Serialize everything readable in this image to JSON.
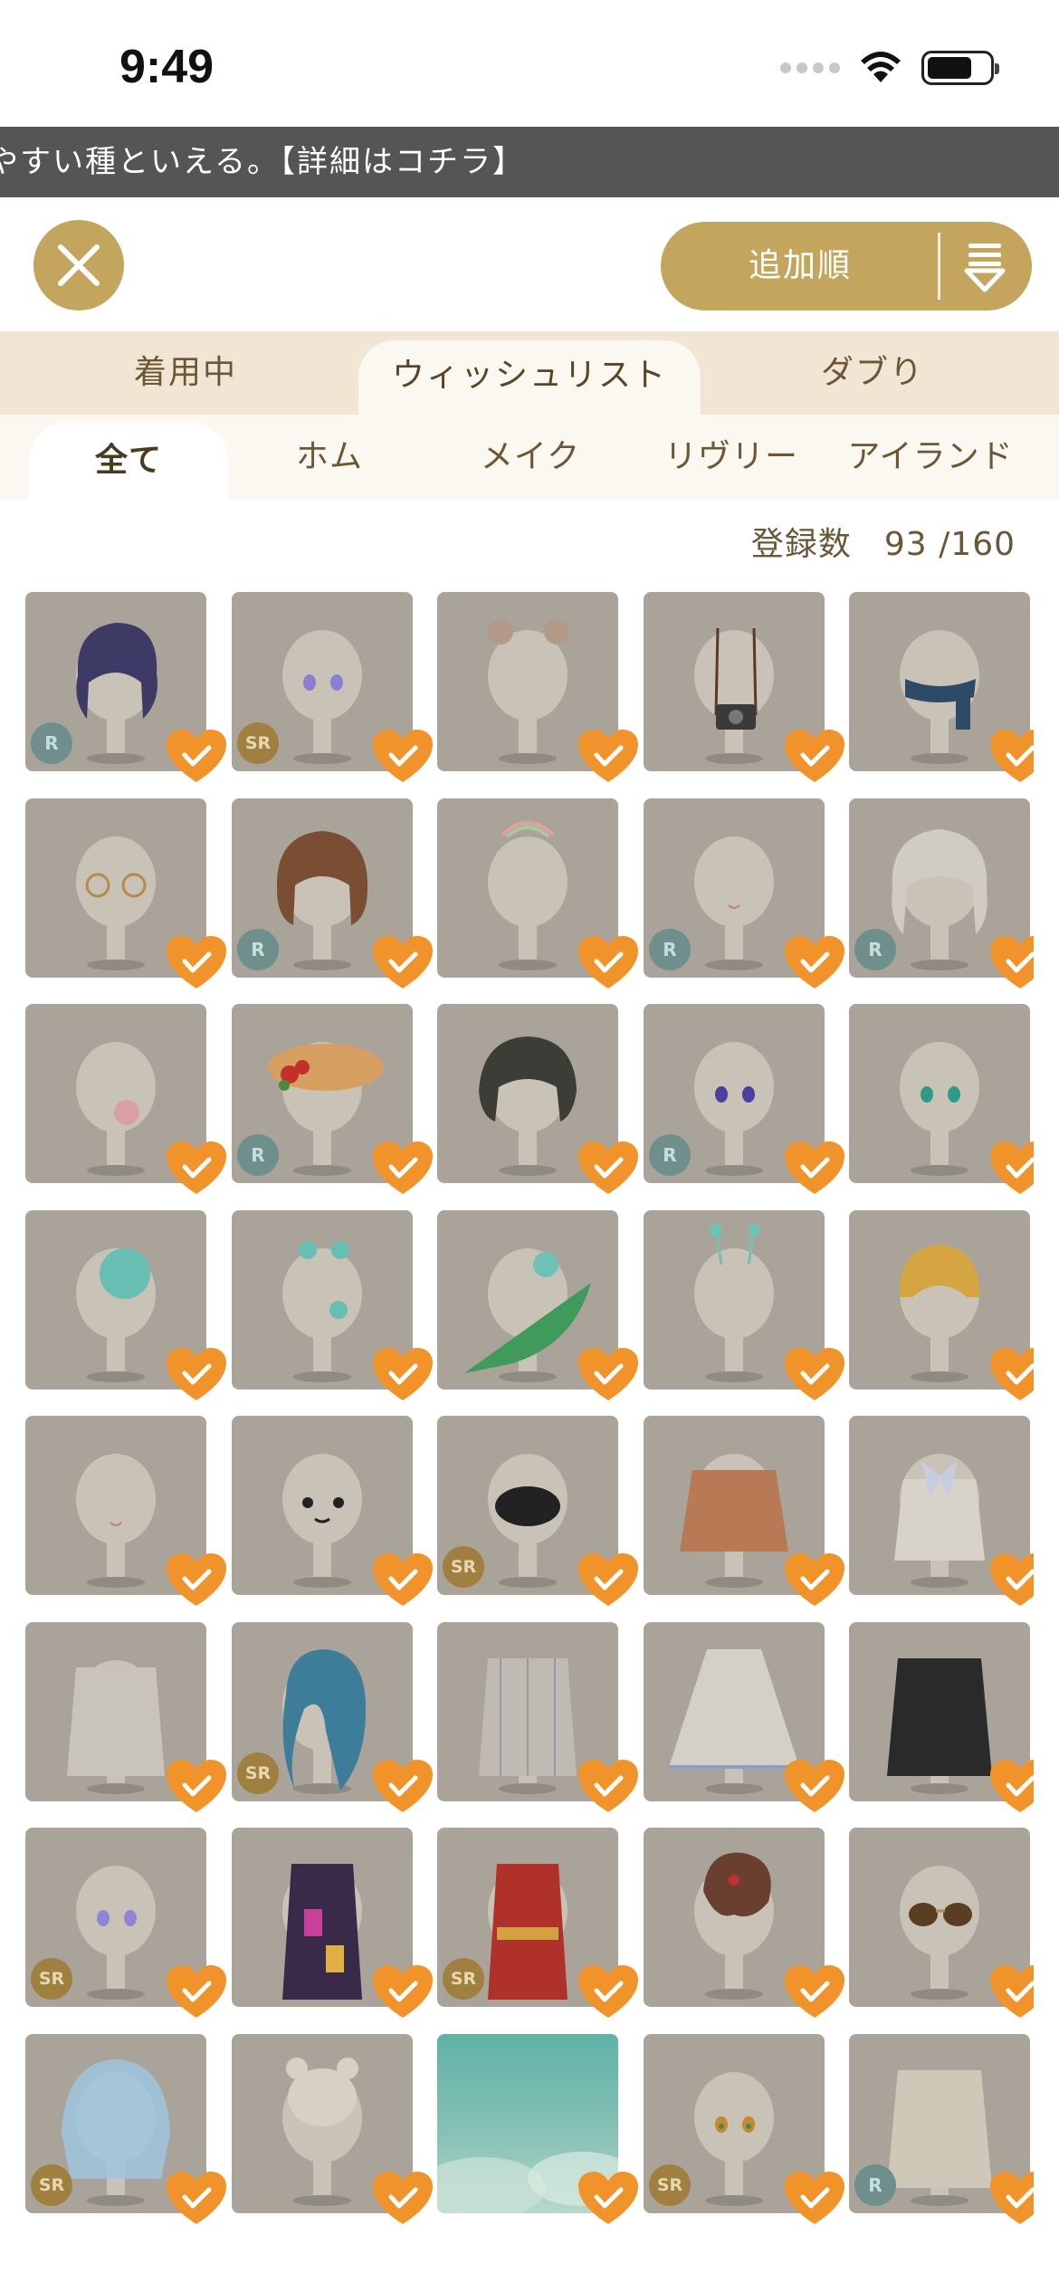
{
  "status_bar": {
    "time": "9:49"
  },
  "ticker": {
    "text": "やすい種といえる。【詳細はコチラ】"
  },
  "header": {
    "sort_label": "追加順"
  },
  "main_tabs": [
    {
      "label": "着用中",
      "active": false
    },
    {
      "label": "ウィッシュリスト",
      "active": true
    },
    {
      "label": "ダブり",
      "active": false
    }
  ],
  "sub_tabs": [
    {
      "label": "全て",
      "active": true
    },
    {
      "label": "ホム",
      "active": false
    },
    {
      "label": "メイク",
      "active": false
    },
    {
      "label": "リヴリー",
      "active": false
    },
    {
      "label": "アイランド",
      "active": false
    }
  ],
  "count": {
    "label": "登録数",
    "value": "93 /160"
  },
  "colors": {
    "accent": "#c4a55d",
    "heart": "#f0932b",
    "tab_bg": "#f0e6d3"
  },
  "items": [
    {
      "kind": "navy-hair",
      "rarity": "R"
    },
    {
      "kind": "purple-eyes",
      "rarity": "SR"
    },
    {
      "kind": "bear-ears",
      "rarity": ""
    },
    {
      "kind": "camera-strap",
      "rarity": ""
    },
    {
      "kind": "navy-scarf",
      "rarity": ""
    },
    {
      "kind": "round-glasses",
      "rarity": ""
    },
    {
      "kind": "brown-bob-hair",
      "rarity": "R"
    },
    {
      "kind": "rainbow-halo",
      "rarity": ""
    },
    {
      "kind": "small-mouth",
      "rarity": "R"
    },
    {
      "kind": "white-wavy-hair",
      "rarity": "R"
    },
    {
      "kind": "bubble-gum",
      "rarity": ""
    },
    {
      "kind": "flower-straw-hat",
      "rarity": "R"
    },
    {
      "kind": "dark-messy-hair",
      "rarity": ""
    },
    {
      "kind": "indigo-eyes",
      "rarity": "R"
    },
    {
      "kind": "teal-eyes",
      "rarity": ""
    },
    {
      "kind": "snail-shell-body",
      "rarity": ""
    },
    {
      "kind": "snail-accessories",
      "rarity": ""
    },
    {
      "kind": "green-leaf",
      "rarity": ""
    },
    {
      "kind": "antenna-headband",
      "rarity": ""
    },
    {
      "kind": "yellow-bob-hair",
      "rarity": ""
    },
    {
      "kind": "blush-mouth",
      "rarity": ""
    },
    {
      "kind": "cat-face",
      "rarity": ""
    },
    {
      "kind": "black-cat-scarf",
      "rarity": "SR"
    },
    {
      "kind": "brown-jacket",
      "rarity": ""
    },
    {
      "kind": "ribbon-blouse",
      "rarity": ""
    },
    {
      "kind": "white-cardigan",
      "rarity": ""
    },
    {
      "kind": "blue-long-hair",
      "rarity": "SR"
    },
    {
      "kind": "striped-shirt",
      "rarity": ""
    },
    {
      "kind": "pleated-skirt",
      "rarity": ""
    },
    {
      "kind": "black-jacket",
      "rarity": ""
    },
    {
      "kind": "lavender-eyes",
      "rarity": "SR"
    },
    {
      "kind": "patterned-kimono",
      "rarity": ""
    },
    {
      "kind": "red-kimono",
      "rarity": "SR"
    },
    {
      "kind": "chestnut-bun-hair",
      "rarity": ""
    },
    {
      "kind": "sunglasses",
      "rarity": ""
    },
    {
      "kind": "jelly-hood",
      "rarity": "SR"
    },
    {
      "kind": "bear-mascot",
      "rarity": ""
    },
    {
      "kind": "sky-background",
      "rarity": ""
    },
    {
      "kind": "amber-eyes",
      "rarity": "SR"
    },
    {
      "kind": "knit-sweater",
      "rarity": "R"
    }
  ]
}
